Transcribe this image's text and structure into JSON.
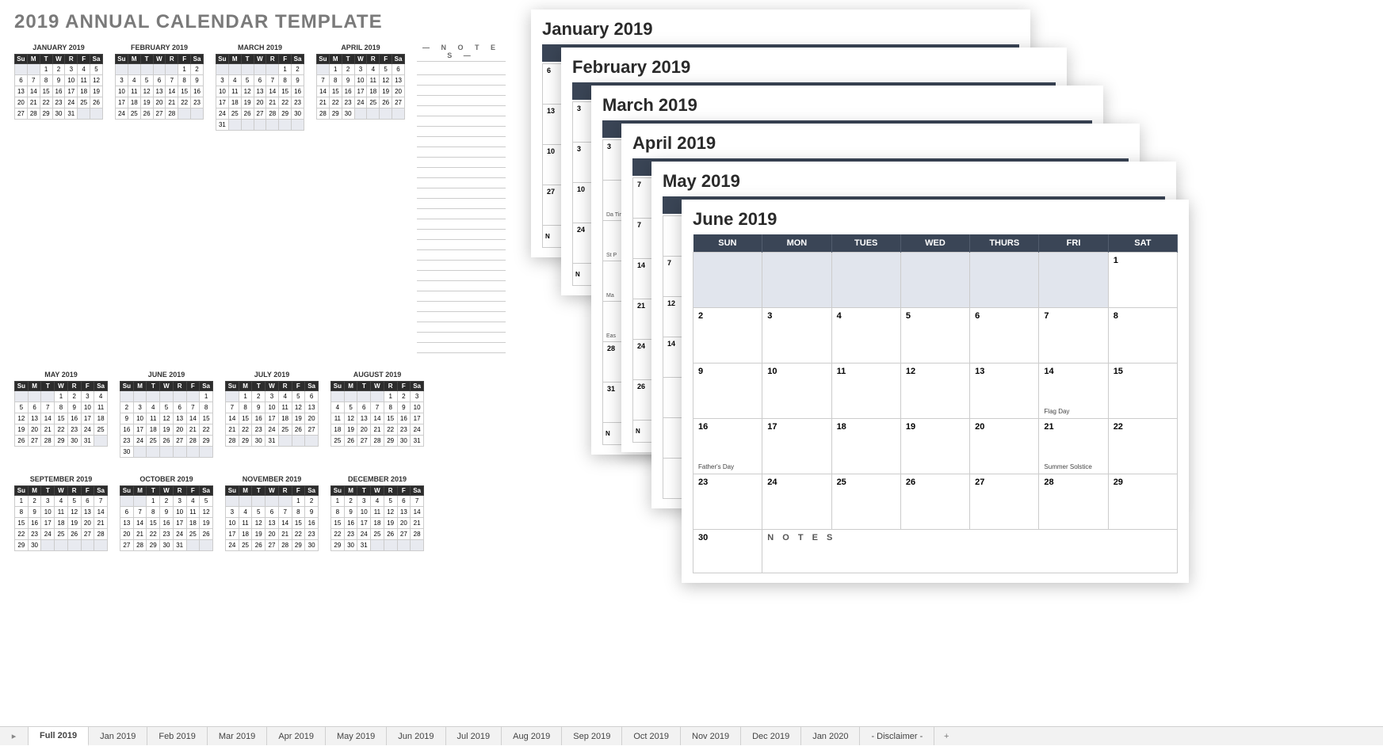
{
  "title": "2019 ANNUAL CALENDAR TEMPLATE",
  "notes_header": "— N O T E S —",
  "day_headers": [
    "Su",
    "M",
    "T",
    "W",
    "R",
    "F",
    "Sa"
  ],
  "big_day_headers": [
    "SUN",
    "MON",
    "TUES",
    "WED",
    "THURS",
    "FRI",
    "SAT"
  ],
  "months": [
    {
      "name": "JANUARY 2019",
      "start": 2,
      "days": 31,
      "show31_newrow": false
    },
    {
      "name": "FEBRUARY 2019",
      "start": 5,
      "days": 28,
      "show31_newrow": false
    },
    {
      "name": "MARCH 2019",
      "start": 5,
      "days": 31,
      "show31_newrow": true
    },
    {
      "name": "APRIL 2019",
      "start": 1,
      "days": 30,
      "show31_newrow": false
    },
    {
      "name": "MAY 2019",
      "start": 3,
      "days": 31,
      "show31_newrow": false
    },
    {
      "name": "JUNE 2019",
      "start": 6,
      "days": 30,
      "show31_newrow": true
    },
    {
      "name": "JULY 2019",
      "start": 1,
      "days": 31,
      "show31_newrow": false
    },
    {
      "name": "AUGUST 2019",
      "start": 4,
      "days": 31,
      "show31_newrow": false
    },
    {
      "name": "SEPTEMBER 2019",
      "start": 0,
      "days": 30,
      "show31_newrow": false
    },
    {
      "name": "OCTOBER 2019",
      "start": 2,
      "days": 31,
      "show31_newrow": false
    },
    {
      "name": "NOVEMBER 2019",
      "start": 5,
      "days": 30,
      "show31_newrow": false
    },
    {
      "name": "DECEMBER 2019",
      "start": 0,
      "days": 31,
      "show31_newrow": false
    }
  ],
  "stack_titles": [
    "January 2019",
    "February 2019",
    "March 2019",
    "April 2019",
    "May 2019",
    "June 2019"
  ],
  "jan_peek_cells": [
    "6",
    "13",
    "10",
    "27",
    "N"
  ],
  "feb_peek_cells": [
    "3",
    "3",
    "10",
    "24",
    "N"
  ],
  "mar_peek": [
    {
      "d": "3",
      "ev": ""
    },
    {
      "d": "",
      "ev": "Da\nTim"
    },
    {
      "d": "",
      "ev": "St P"
    },
    {
      "d": "",
      "ev": "Ma"
    },
    {
      "d": "",
      "ev": "Eas"
    },
    {
      "d": "28",
      "ev": ""
    },
    {
      "d": "31",
      "ev": ""
    },
    {
      "d": "N",
      "ev": ""
    }
  ],
  "apr_peek": [
    "7",
    "7",
    "14",
    "21",
    "24",
    "26",
    "N"
  ],
  "may_peek": [
    "",
    "7",
    "12",
    "14",
    "",
    "",
    ""
  ],
  "june": {
    "title": "June 2019",
    "grid": [
      [
        {
          "d": "",
          "f": true
        },
        {
          "d": "",
          "f": true
        },
        {
          "d": "",
          "f": true
        },
        {
          "d": "",
          "f": true
        },
        {
          "d": "",
          "f": true
        },
        {
          "d": "",
          "f": true
        },
        {
          "d": "1"
        }
      ],
      [
        {
          "d": "2"
        },
        {
          "d": "3"
        },
        {
          "d": "4"
        },
        {
          "d": "5"
        },
        {
          "d": "6"
        },
        {
          "d": "7"
        },
        {
          "d": "8"
        }
      ],
      [
        {
          "d": "9"
        },
        {
          "d": "10"
        },
        {
          "d": "11"
        },
        {
          "d": "12"
        },
        {
          "d": "13"
        },
        {
          "d": "14",
          "ev": "Flag Day"
        },
        {
          "d": "15"
        }
      ],
      [
        {
          "d": "16",
          "ev": "Father's Day"
        },
        {
          "d": "17"
        },
        {
          "d": "18"
        },
        {
          "d": "19"
        },
        {
          "d": "20"
        },
        {
          "d": "21",
          "ev": "Summer Solstice"
        },
        {
          "d": "22"
        }
      ],
      [
        {
          "d": "23"
        },
        {
          "d": "24"
        },
        {
          "d": "25"
        },
        {
          "d": "26"
        },
        {
          "d": "27"
        },
        {
          "d": "28"
        },
        {
          "d": "29"
        }
      ]
    ],
    "last_30": "30",
    "notes_label": "N O T E S"
  },
  "tabs": [
    "Full 2019",
    "Jan 2019",
    "Feb 2019",
    "Mar 2019",
    "Apr 2019",
    "May 2019",
    "Jun 2019",
    "Jul 2019",
    "Aug 2019",
    "Sep 2019",
    "Oct 2019",
    "Nov 2019",
    "Dec 2019",
    "Jan 2020",
    "- Disclaimer -"
  ],
  "active_tab": 0
}
